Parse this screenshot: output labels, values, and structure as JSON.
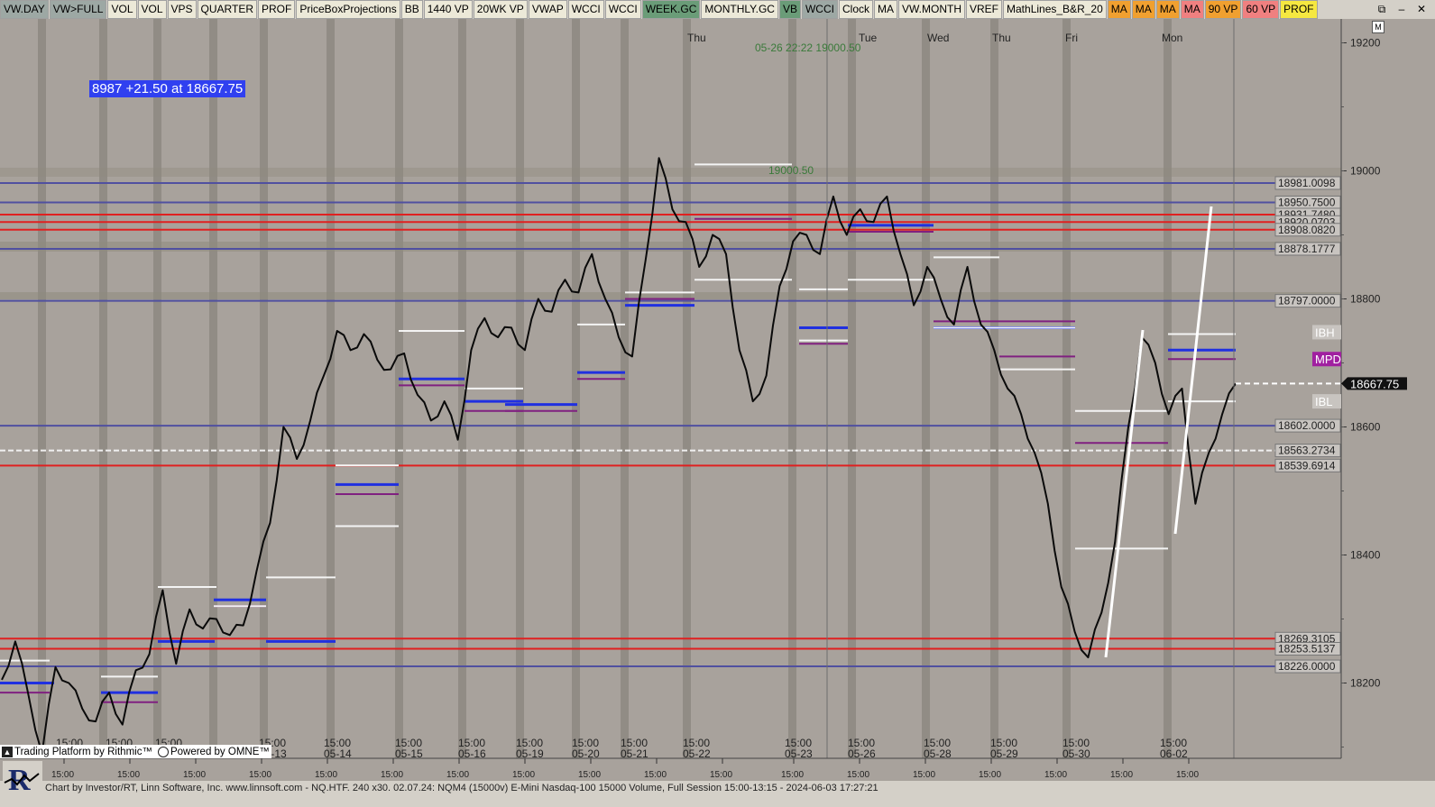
{
  "toolbar": {
    "buttons": [
      {
        "label": "VW.DAY",
        "style": "sel"
      },
      {
        "label": "VW>FULL",
        "style": "sel"
      },
      {
        "label": "VOL",
        "style": ""
      },
      {
        "label": "VOL",
        "style": ""
      },
      {
        "label": "VPS",
        "style": ""
      },
      {
        "label": "QUARTER",
        "style": ""
      },
      {
        "label": "PROF",
        "style": ""
      },
      {
        "label": "PriceBoxProjections",
        "style": ""
      },
      {
        "label": "BB",
        "style": ""
      },
      {
        "label": "1440 VP",
        "style": ""
      },
      {
        "label": "20WK VP",
        "style": ""
      },
      {
        "label": "VWAP",
        "style": ""
      },
      {
        "label": "WCCI",
        "style": ""
      },
      {
        "label": "WCCI",
        "style": ""
      },
      {
        "label": "WEEK.GC",
        "style": "green"
      },
      {
        "label": "MONTHLY.GC",
        "style": ""
      },
      {
        "label": "VB",
        "style": "green"
      },
      {
        "label": "WCCI",
        "style": "sel"
      },
      {
        "label": "Clock",
        "style": ""
      },
      {
        "label": "MA",
        "style": ""
      },
      {
        "label": "VW.MONTH",
        "style": ""
      },
      {
        "label": "VREF",
        "style": ""
      },
      {
        "label": "MathLines_B&R_20",
        "style": ""
      },
      {
        "label": "MA",
        "style": "orange"
      },
      {
        "label": "MA",
        "style": "orange"
      },
      {
        "label": "MA",
        "style": "orange"
      },
      {
        "label": "MA",
        "style": "red"
      },
      {
        "label": "90 VP",
        "style": "orange"
      },
      {
        "label": "60 VP",
        "style": "red"
      },
      {
        "label": "PROF",
        "style": "yellow"
      }
    ],
    "window_controls": [
      "⧉",
      "–",
      "✕"
    ]
  },
  "info_box": "8987  +21.50 at 18667.75",
  "m_box": "M",
  "top_annotation": "05-26 22:22  19000.50",
  "level_annotation": "19000.50",
  "footer_text": "Chart by Investor/RT, Linn Software, Inc. www.linnsoft.com - NQ.HTF.  240 x30.   02.07.24: NQM4 (15000v) E-Mini Nasdaq-100 15000 Volume, Full Session 15:00-13:15 - 2024-06-03 17:27:21",
  "rithmic_text": "Trading Platform by Rithmic™",
  "omne_text": "Powered by OMNE™",
  "chart_data": {
    "type": "line",
    "instrument": "NQM4",
    "ylim": [
      18070,
      19270
    ],
    "y_ticks": [
      18200,
      18400,
      18600,
      18800,
      19000,
      19200
    ],
    "day_labels": [
      "Thu",
      "Tue",
      "Wed",
      "Thu",
      "Fri",
      "Mon"
    ],
    "session_labels": [
      {
        "time": "15:00",
        "date": "05-13"
      },
      {
        "time": "15:00",
        "date": "05-14"
      },
      {
        "time": "15:00",
        "date": "05-15"
      },
      {
        "time": "15:00",
        "date": "05-16"
      },
      {
        "time": "15:00",
        "date": "05-19"
      },
      {
        "time": "15:00",
        "date": "05-20"
      },
      {
        "time": "15:00",
        "date": "05-21"
      },
      {
        "time": "15:00",
        "date": "05-22"
      },
      {
        "time": "15:00",
        "date": "05-23"
      },
      {
        "time": "15:00",
        "date": "05-26"
      },
      {
        "time": "15:00",
        "date": "05-28"
      },
      {
        "time": "15:00",
        "date": "05-29"
      },
      {
        "time": "15:00",
        "date": "05-30"
      },
      {
        "time": "15:00",
        "date": "06-02"
      }
    ],
    "partial_session_times": [
      "15:00",
      "15:00",
      "15:00"
    ],
    "bottom_axis_times": [
      "15:00",
      "15:00",
      "15:00",
      "15:00",
      "15:00",
      "15:00",
      "15:00",
      "15:00",
      "15:00",
      "15:00",
      "15:00",
      "15:00",
      "15:00",
      "15:00",
      "15:00",
      "15:00",
      "15:00",
      "15:00"
    ],
    "levels": [
      {
        "label": "18981.0098",
        "value": 18981.0098,
        "color": "#5050a0"
      },
      {
        "label": "18950.7500",
        "value": 18950.75,
        "color": "#5050a0"
      },
      {
        "label": "18931.7480",
        "value": 18931.748,
        "color": "#e02020"
      },
      {
        "label": "18920.0703",
        "value": 18920.0703,
        "color": "#e02020"
      },
      {
        "label": "18908.0820",
        "value": 18908.082,
        "color": "#e02020"
      },
      {
        "label": "18878.1777",
        "value": 18878.1777,
        "color": "#5050a0"
      },
      {
        "label": "18797.0000",
        "value": 18797.0,
        "color": "#5050a0"
      },
      {
        "label": "18602.0000",
        "value": 18602.0,
        "color": "#5050a0"
      },
      {
        "label": "18563.2734",
        "value": 18563.2734,
        "color": "#f0f0f0"
      },
      {
        "label": "18539.6914",
        "value": 18539.6914,
        "color": "#e02020"
      },
      {
        "label": "18269.3105",
        "value": 18269.3105,
        "color": "#e02020"
      },
      {
        "label": "18253.5137",
        "value": 18253.5137,
        "color": "#e02020"
      },
      {
        "label": "18226.0000",
        "value": 18226.0,
        "color": "#5050a0"
      }
    ],
    "right_tags": [
      {
        "label": "IBH",
        "value": 18748,
        "bg": "#c8c4c0",
        "fg": "#ffffff"
      },
      {
        "label": "MPD",
        "value": 18706,
        "bg": "#a020a0",
        "fg": "#ffffff"
      },
      {
        "label": "IBL",
        "value": 18640,
        "bg": "#c8c4c0",
        "fg": "#ffffff"
      }
    ],
    "last_price": {
      "label": "18667.75",
      "value": 18667.75
    },
    "series": [
      {
        "values": [
          18205,
          18265,
          18180,
          18090,
          18225,
          18200,
          18160,
          18140,
          18185,
          18135,
          18220,
          18245,
          18345,
          18230,
          18315,
          18285,
          18300,
          18275,
          18290,
          18375,
          18450,
          18600,
          18550,
          18610,
          18680,
          18750,
          18720,
          18745,
          18705,
          18690,
          18715,
          18650,
          18610,
          18640,
          18580,
          18720,
          18770,
          18740,
          18755,
          18720,
          18800,
          18780,
          18830,
          18810,
          18870,
          18800,
          18740,
          18710,
          18860,
          19020,
          18940,
          18920,
          18850,
          18900,
          18870,
          18720,
          18640,
          18680,
          18820,
          18890,
          18900,
          18870,
          18960,
          18900,
          18940,
          18920,
          18960,
          18870,
          18790,
          18850,
          18800,
          18760,
          18850,
          18760,
          18720,
          18660,
          18620,
          18560,
          18480,
          18350,
          18280,
          18240,
          18310,
          18420,
          18600,
          18740,
          18700,
          18620,
          18660,
          18480,
          18560,
          18620,
          18667.75
        ]
      }
    ]
  }
}
